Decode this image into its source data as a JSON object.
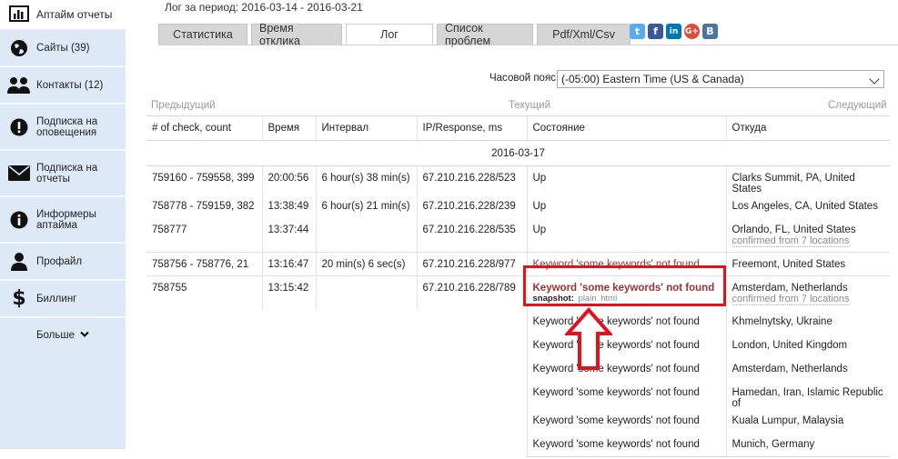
{
  "sidebar": {
    "top_label": "Аптайм отчеты",
    "items": [
      {
        "icon": "globe-icon",
        "label": "Сайты (39)"
      },
      {
        "icon": "users-icon",
        "label": "Контакты (12)"
      },
      {
        "icon": "alert-icon",
        "label": "Подписка на оповещения"
      },
      {
        "icon": "envelope-icon",
        "label": "Подписка на отчеты"
      },
      {
        "icon": "info-icon",
        "label": "Информеры аптайма"
      },
      {
        "icon": "user-icon",
        "label": "Профайл"
      },
      {
        "icon": "dollar-icon",
        "label": "Биллинг"
      }
    ],
    "more_label": "Больше"
  },
  "header": {
    "period_label": "Лог за период:",
    "period_value": "2016-03-14 - 2016-03-21"
  },
  "tabs": [
    "Статистика",
    "Время отклика",
    "Лог",
    "Список проблем",
    "Pdf/Xml/Csv"
  ],
  "active_tab": "Лог",
  "social": [
    {
      "icon": "twitter-icon",
      "glyph": "t",
      "color": "#55acee"
    },
    {
      "icon": "facebook-icon",
      "glyph": "f",
      "color": "#3b5998"
    },
    {
      "icon": "linkedin-icon",
      "glyph": "in",
      "color": "#0077b5"
    },
    {
      "icon": "googleplus-icon",
      "glyph": "G+",
      "color": "#dd4b39"
    },
    {
      "icon": "vk-icon",
      "glyph": "B",
      "color": "#4c75a3"
    }
  ],
  "timezone": {
    "label": "Часовой пояс:",
    "value": "(-05:00) Eastern Time (US & Canada)"
  },
  "pager": {
    "prev": "Предыдущий",
    "current": "Текущий",
    "next": "Следующий"
  },
  "table": {
    "headers": [
      "# of check, count",
      "Время",
      "Интервал",
      "IP/Response, ms",
      "Состояние",
      "Откуда"
    ],
    "date": "2016-03-17",
    "rows": [
      {
        "check": "759160 - 759558, 399",
        "time": "20:00:56",
        "interval": "6 hour(s) 38 min(s)",
        "ip": "67.210.216.228/523",
        "state": "Up",
        "state_error": false,
        "from": "Clarks Summit, PA, United States",
        "from_sub": ""
      },
      {
        "check": "758778 - 759159, 382",
        "time": "13:38:49",
        "interval": "6 hour(s) 21 min(s)",
        "ip": "67.210.216.228/239",
        "state": "Up",
        "state_error": false,
        "from": "Los Angeles, CA, United States",
        "from_sub": ""
      },
      {
        "check": "758777",
        "time": "13:37:44",
        "interval": "",
        "ip": "67.210.216.228/535",
        "state": "Up",
        "state_error": false,
        "from": "Orlando, FL, United States",
        "from_sub": "confirmed from 7 locations"
      },
      {
        "check": "758756 - 758776, 21",
        "time": "13:16:47",
        "interval": "20 min(s) 6 sec(s)",
        "ip": "67.210.216.228/977",
        "state": "Keyword 'some keywords' not found",
        "state_error": true,
        "from": "Freemont, United States",
        "from_sub": ""
      },
      {
        "check": "758755",
        "time": "13:15:42",
        "interval": "",
        "ip": "67.210.216.228/789",
        "state": "Keyword 'some keywords' not found",
        "state_error": true,
        "snapshot": {
          "label": "snapshot:",
          "plain": "plain",
          "html": "html"
        },
        "from": "Amsterdam, Netherlands",
        "from_sub": "confirmed from 7 locations"
      }
    ],
    "sub_rows": [
      {
        "state": "Keyword 'some keywords' not found",
        "from": "Khmelnytsky, Ukraine"
      },
      {
        "state": "Keyword 'some keywords' not found",
        "from": "London, United Kingdom"
      },
      {
        "state": "Keyword 'some keywords' not found",
        "from": "Amsterdam, Netherlands"
      },
      {
        "state": "Keyword 'some keywords' not found",
        "from": "Hamedan, Iran, Islamic Republic of"
      },
      {
        "state": "Keyword 'some keywords' not found",
        "from": "Kuala Lumpur, Malaysia"
      },
      {
        "state": "Keyword 'some keywords' not found",
        "from": "Munich, Germany"
      }
    ]
  },
  "annotation": {
    "box_color": "#e3111b",
    "arrow_color": "#e3111b"
  }
}
